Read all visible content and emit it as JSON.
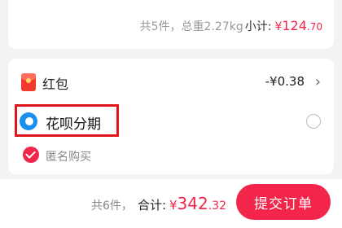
{
  "order_summary": {
    "item_meta": "共5件，总重2.27kg",
    "subtotal_label": "小计:",
    "currency": "¥",
    "subtotal_integer": "124",
    "subtotal_decimal": ".70"
  },
  "discounts": {
    "red_packet_label": "红包",
    "red_packet_amount": "-¥0.38",
    "huabei_label": "花呗分期",
    "huabei_selected": false,
    "anonymous_label": "匿名购买",
    "anonymous_checked": true
  },
  "footer": {
    "total_count": "共6件，",
    "total_label": "合计:",
    "currency": "¥",
    "total_integer": "342",
    "total_decimal": ".32",
    "submit_label": "提交订单"
  },
  "colors": {
    "accent": "#f2264a",
    "highlight_box": "#e2141b",
    "huabei_blue": "#1b8ff0",
    "background": "#f3f3f3"
  },
  "icons": {
    "red_packet": "red-packet-icon",
    "huabei": "huabei-icon",
    "chevron": "chevron-right-icon",
    "check": "checkmark-circle-icon"
  }
}
